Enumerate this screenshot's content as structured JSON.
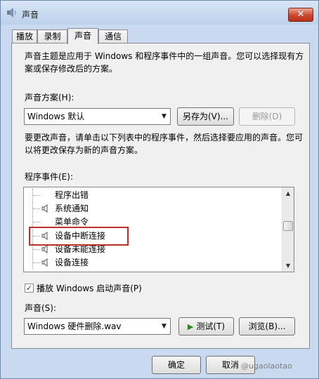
{
  "window": {
    "title": "声音",
    "close_label": "✕"
  },
  "tabs": [
    {
      "label": "播放"
    },
    {
      "label": "录制"
    },
    {
      "label": "声音"
    },
    {
      "label": "通信"
    }
  ],
  "intro_text_line1": "声音主题是应用于 Windows 和程序事件中的一组声音。您可以选择现有方",
  "intro_text_line2": "案或保存修改后的方案。",
  "scheme": {
    "label": "声音方案(H):",
    "selected": "Windows 默认",
    "save_as_label": "另存为(V)...",
    "delete_label": "删除(D)"
  },
  "instructions_line1": "要更改声音，请单击以下列表中的程序事件，然后选择要应用的声音。您可",
  "instructions_line2": "以将更改保存为新的声音方案。",
  "program_events": {
    "label": "程序事件(E):",
    "items": [
      {
        "label": "程序出错",
        "has_sound": false
      },
      {
        "label": "系统通知",
        "has_sound": true
      },
      {
        "label": "菜单命令",
        "has_sound": false
      },
      {
        "label": "设备中断连接",
        "has_sound": true
      },
      {
        "label": "设备未能连接",
        "has_sound": true
      },
      {
        "label": "设备连接",
        "has_sound": true
      }
    ]
  },
  "startup_sound": {
    "label": "播放 Windows 启动声音(P)",
    "checked": true
  },
  "sound": {
    "label": "声音(S):",
    "selected": "Windows 硬件删除.wav",
    "test_label": "测试(T)",
    "browse_label": "浏览(B)..."
  },
  "footer": {
    "ok_label": "确定",
    "cancel_label": "取消"
  },
  "watermark_text": "@ugaolaotao"
}
